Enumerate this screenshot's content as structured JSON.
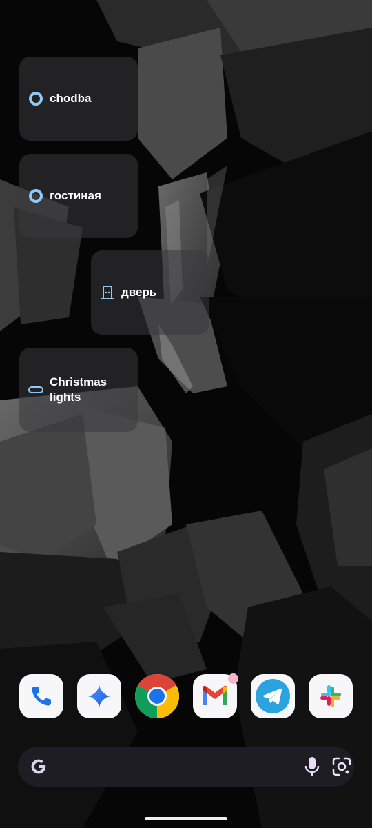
{
  "widgets": [
    {
      "label": "chodba",
      "icon": "ring-icon"
    },
    {
      "label": "гостиная",
      "icon": "ring-icon"
    },
    {
      "label": "дверь",
      "icon": "door-icon"
    },
    {
      "label": "Christmas lights",
      "icon": "light-strip-icon"
    }
  ],
  "dock": [
    {
      "app": "Phone",
      "icon": "phone-icon"
    },
    {
      "app": "Gemini",
      "icon": "gemini-icon"
    },
    {
      "app": "Chrome",
      "icon": "chrome-icon"
    },
    {
      "app": "Gmail",
      "icon": "gmail-icon",
      "has_notification_dot": true
    },
    {
      "app": "Telegram",
      "icon": "telegram-icon"
    },
    {
      "app": "Slack",
      "icon": "slack-icon"
    }
  ],
  "search_bar": {
    "value": "",
    "icons": [
      "google-g-icon",
      "microphone-icon",
      "google-lens-icon"
    ]
  },
  "colors": {
    "widget_icon": "#8ec9f7",
    "widget_text": "#ffffff",
    "search_bar_bg": "#1f1d24"
  }
}
